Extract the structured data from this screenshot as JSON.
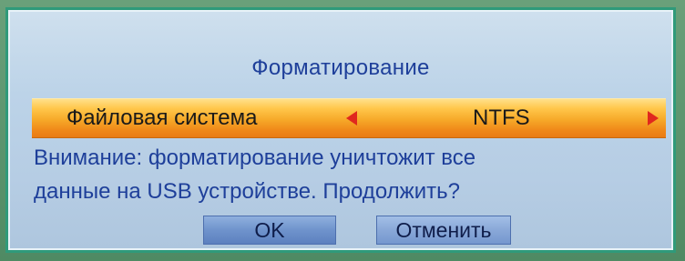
{
  "dialog": {
    "title": "Форматирование",
    "filesystem": {
      "label": "Файловая система",
      "value": "NTFS",
      "left_arrow_icon": "arrow-left-icon",
      "right_arrow_icon": "arrow-right-icon",
      "arrow_color": "#e0281e",
      "highlight_color": "#f6a828"
    },
    "warning_line1": "Внимание: форматирование уничтожит все",
    "warning_line2": "данные на USB устройстве. Продолжить?",
    "buttons": {
      "ok_label": "OK",
      "cancel_label": "Отменить"
    },
    "text_color": "#1e3f9a",
    "border_color": "#2f9a7a"
  }
}
